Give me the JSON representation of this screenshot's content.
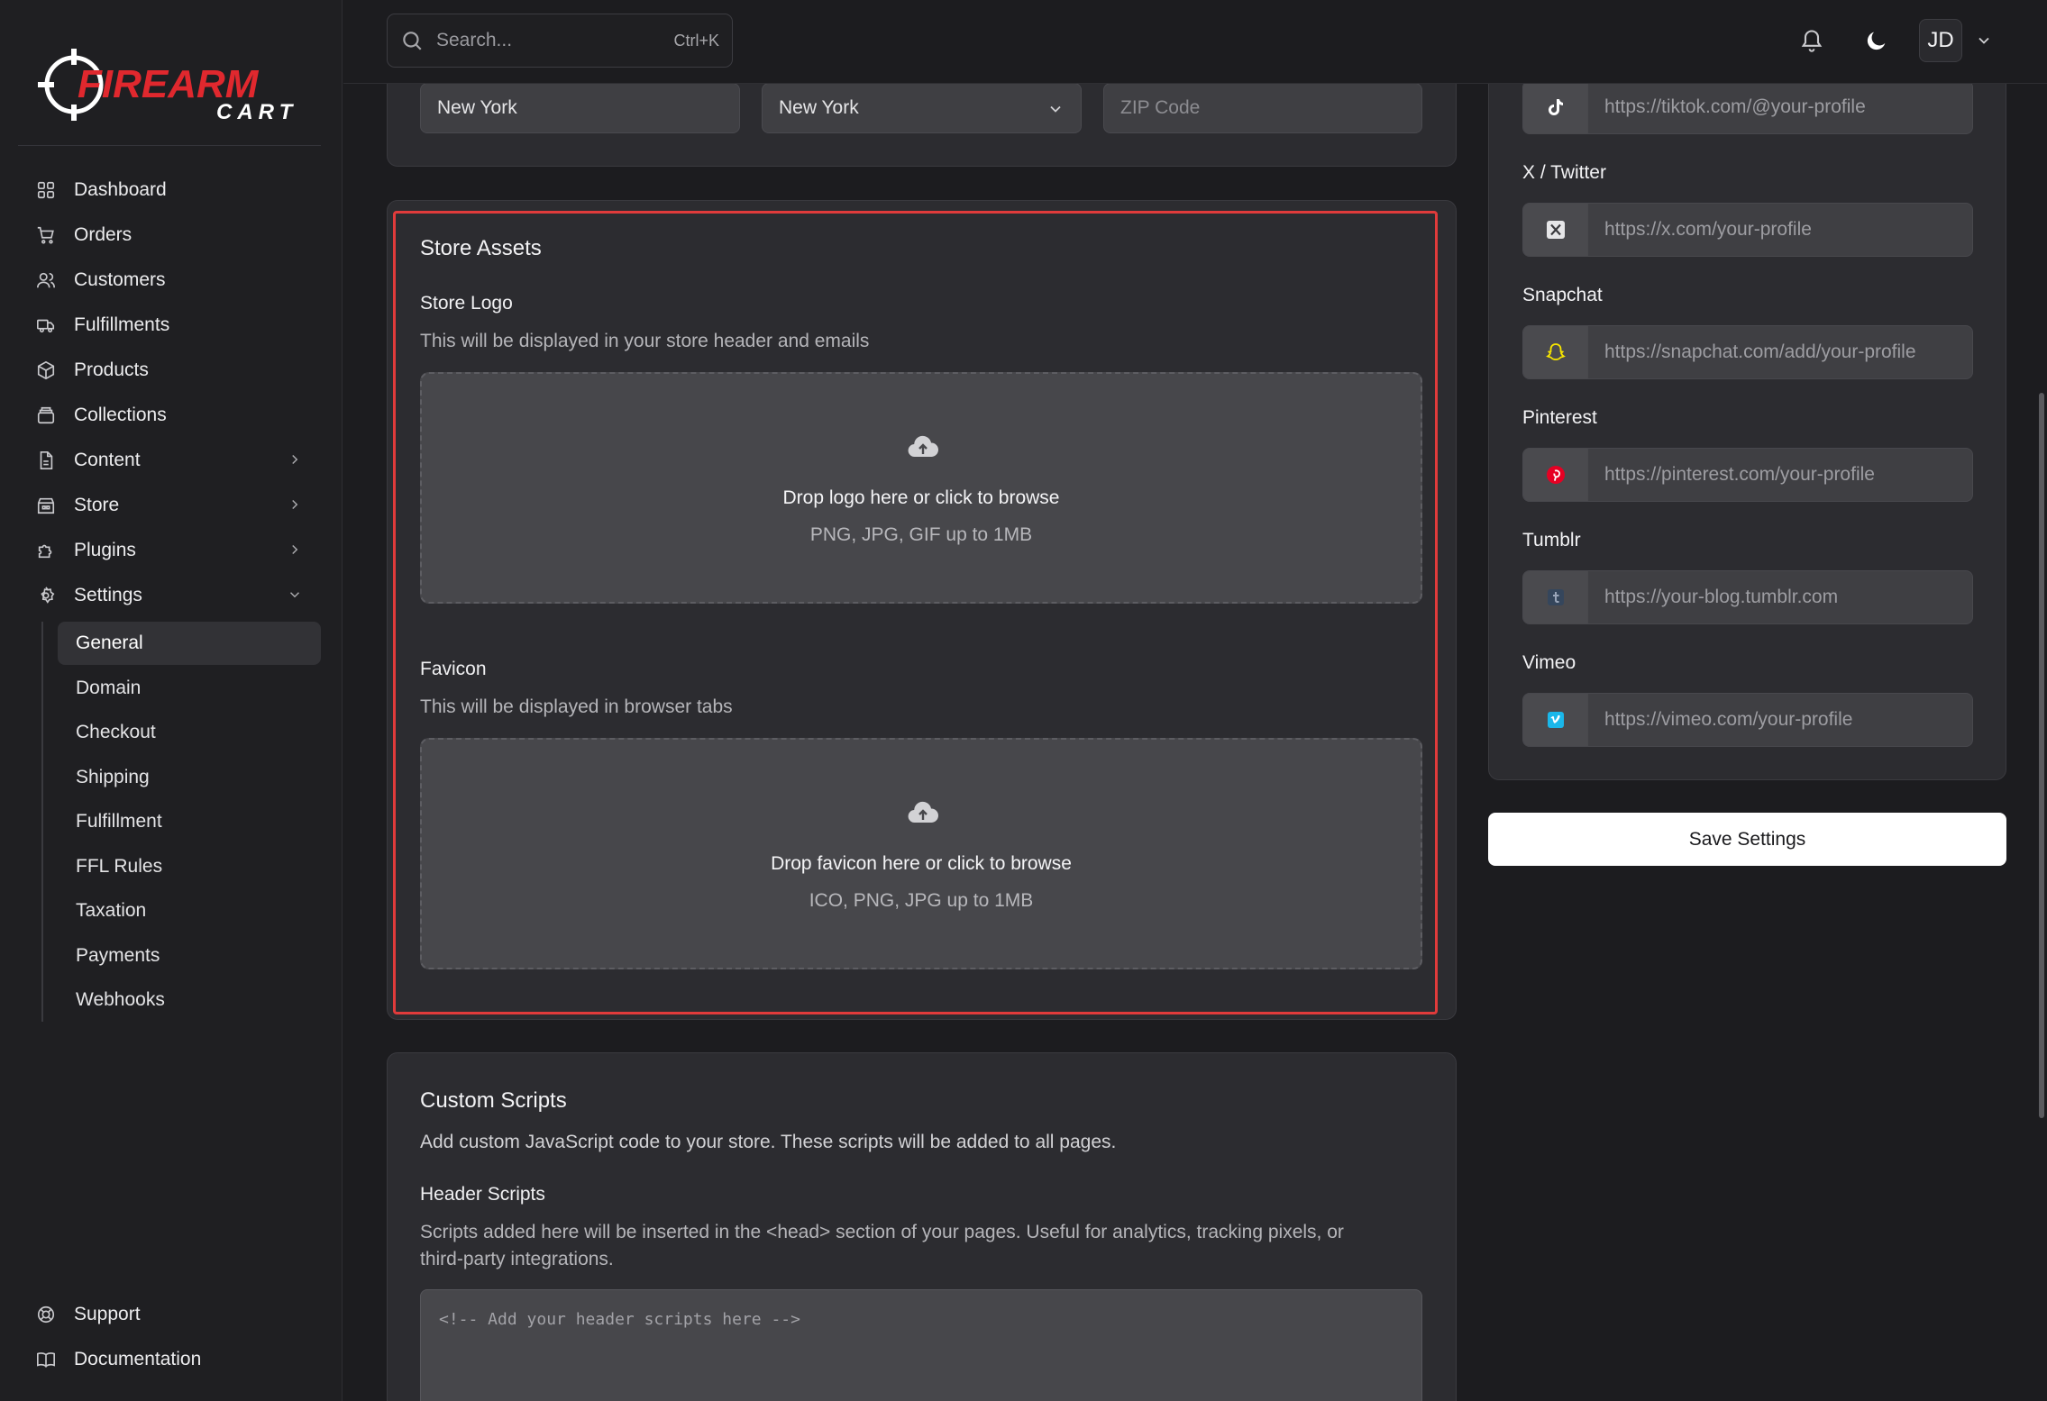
{
  "brand": {
    "line1": "FIREARM",
    "line2": "CART",
    "accent": "#e0282e"
  },
  "search": {
    "placeholder": "Search...",
    "shortcut": "Ctrl+K"
  },
  "user": {
    "initials": "JD"
  },
  "nav": {
    "items": [
      {
        "label": "Dashboard",
        "icon": "dashboard-icon"
      },
      {
        "label": "Orders",
        "icon": "cart-icon"
      },
      {
        "label": "Customers",
        "icon": "users-icon"
      },
      {
        "label": "Fulfillments",
        "icon": "truck-icon"
      },
      {
        "label": "Products",
        "icon": "box-icon"
      },
      {
        "label": "Collections",
        "icon": "collection-icon"
      },
      {
        "label": "Content",
        "icon": "file-icon"
      },
      {
        "label": "Store",
        "icon": "store-icon"
      },
      {
        "label": "Plugins",
        "icon": "puzzle-icon"
      },
      {
        "label": "Settings",
        "icon": "gear-icon"
      }
    ],
    "settings_sub": [
      "General",
      "Domain",
      "Checkout",
      "Shipping",
      "Fulfillment",
      "FFL Rules",
      "Taxation",
      "Payments",
      "Webhooks"
    ],
    "bottom": [
      {
        "label": "Support",
        "icon": "lifebuoy-icon"
      },
      {
        "label": "Documentation",
        "icon": "book-icon"
      }
    ]
  },
  "address": {
    "city": "New York",
    "state": "New York",
    "zip_placeholder": "ZIP Code"
  },
  "store_assets": {
    "title": "Store Assets",
    "logo": {
      "label": "Store Logo",
      "description": "This will be displayed in your store header and emails",
      "drop_text": "Drop logo here or click to browse",
      "hint": "PNG, JPG, GIF up to 1MB"
    },
    "favicon": {
      "label": "Favicon",
      "description": "This will be displayed in browser tabs",
      "drop_text": "Drop favicon here or click to browse",
      "hint": "ICO, PNG, JPG up to 1MB"
    }
  },
  "custom_scripts": {
    "title": "Custom Scripts",
    "description": "Add custom JavaScript code to your store. These scripts will be added to all pages.",
    "header_label": "Header Scripts",
    "header_desc_1": "Scripts added here will be inserted in the <head> section of your pages. Useful for analytics, tracking pixels, or",
    "header_desc_2": "third-party integrations.",
    "header_placeholder": "<!-- Add your header scripts here -->"
  },
  "social": {
    "tiktok": {
      "placeholder": "https://tiktok.com/@your-profile"
    },
    "twitter": {
      "label": "X / Twitter",
      "placeholder": "https://x.com/your-profile"
    },
    "snapchat": {
      "label": "Snapchat",
      "placeholder": "https://snapchat.com/add/your-profile",
      "color": "#f7e500"
    },
    "pinterest": {
      "label": "Pinterest",
      "placeholder": "https://pinterest.com/your-profile",
      "color": "#e60023"
    },
    "tumblr": {
      "label": "Tumblr",
      "placeholder": "https://your-blog.tumblr.com",
      "color": "#35465c"
    },
    "vimeo": {
      "label": "Vimeo",
      "placeholder": "https://vimeo.com/your-profile",
      "color": "#1ab7ea"
    }
  },
  "save_label": "Save Settings"
}
